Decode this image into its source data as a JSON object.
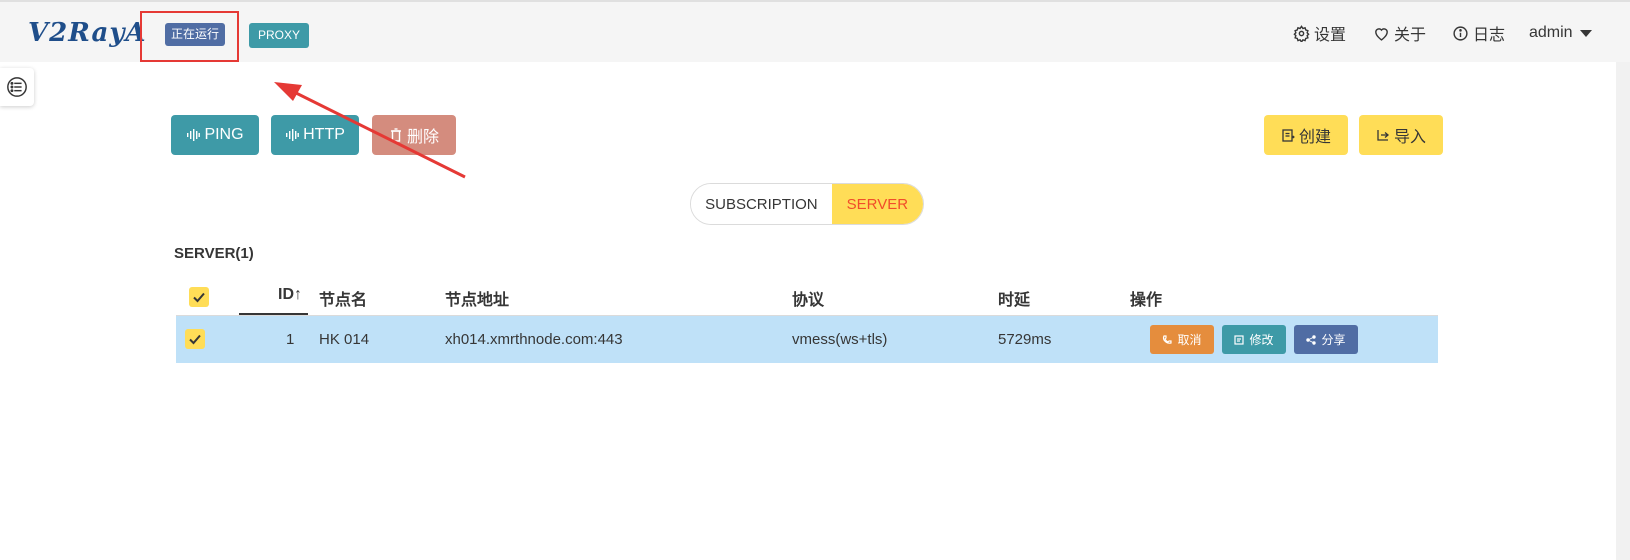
{
  "navbar": {
    "logo": "V2RayA",
    "status_tag": "正在运行",
    "proxy_tag": "PROXY",
    "settings": "设置",
    "about": "关于",
    "log": "日志",
    "user": "admin"
  },
  "toolbar": {
    "ping": "PING",
    "http": "HTTP",
    "delete": "删除",
    "create": "创建",
    "import": "导入"
  },
  "tabs": {
    "subscription": "SUBSCRIPTION",
    "server": "SERVER",
    "active": "SERVER"
  },
  "table": {
    "section_title": "SERVER(1)",
    "sort_indicator": "↑",
    "columns": {
      "id": "ID",
      "name": "节点名",
      "address": "节点地址",
      "protocol": "协议",
      "latency": "时延",
      "actions": "操作"
    },
    "rows": [
      {
        "id": "1",
        "name": "HK 014",
        "address": "xh014.xmrthnode.com:443",
        "protocol": "vmess(ws+tls)",
        "latency": "5729ms",
        "selected": true,
        "actions": {
          "cancel": "取消",
          "edit": "修改",
          "share": "分享"
        }
      }
    ]
  },
  "colors": {
    "primary": "#506da4",
    "info": "#3e9aa7",
    "warning": "#ffdd57",
    "danger_light": "#d48c7e",
    "row_selected": "#bfe1f8",
    "cancel": "#e58d3d",
    "annotation_red": "#e53935"
  }
}
